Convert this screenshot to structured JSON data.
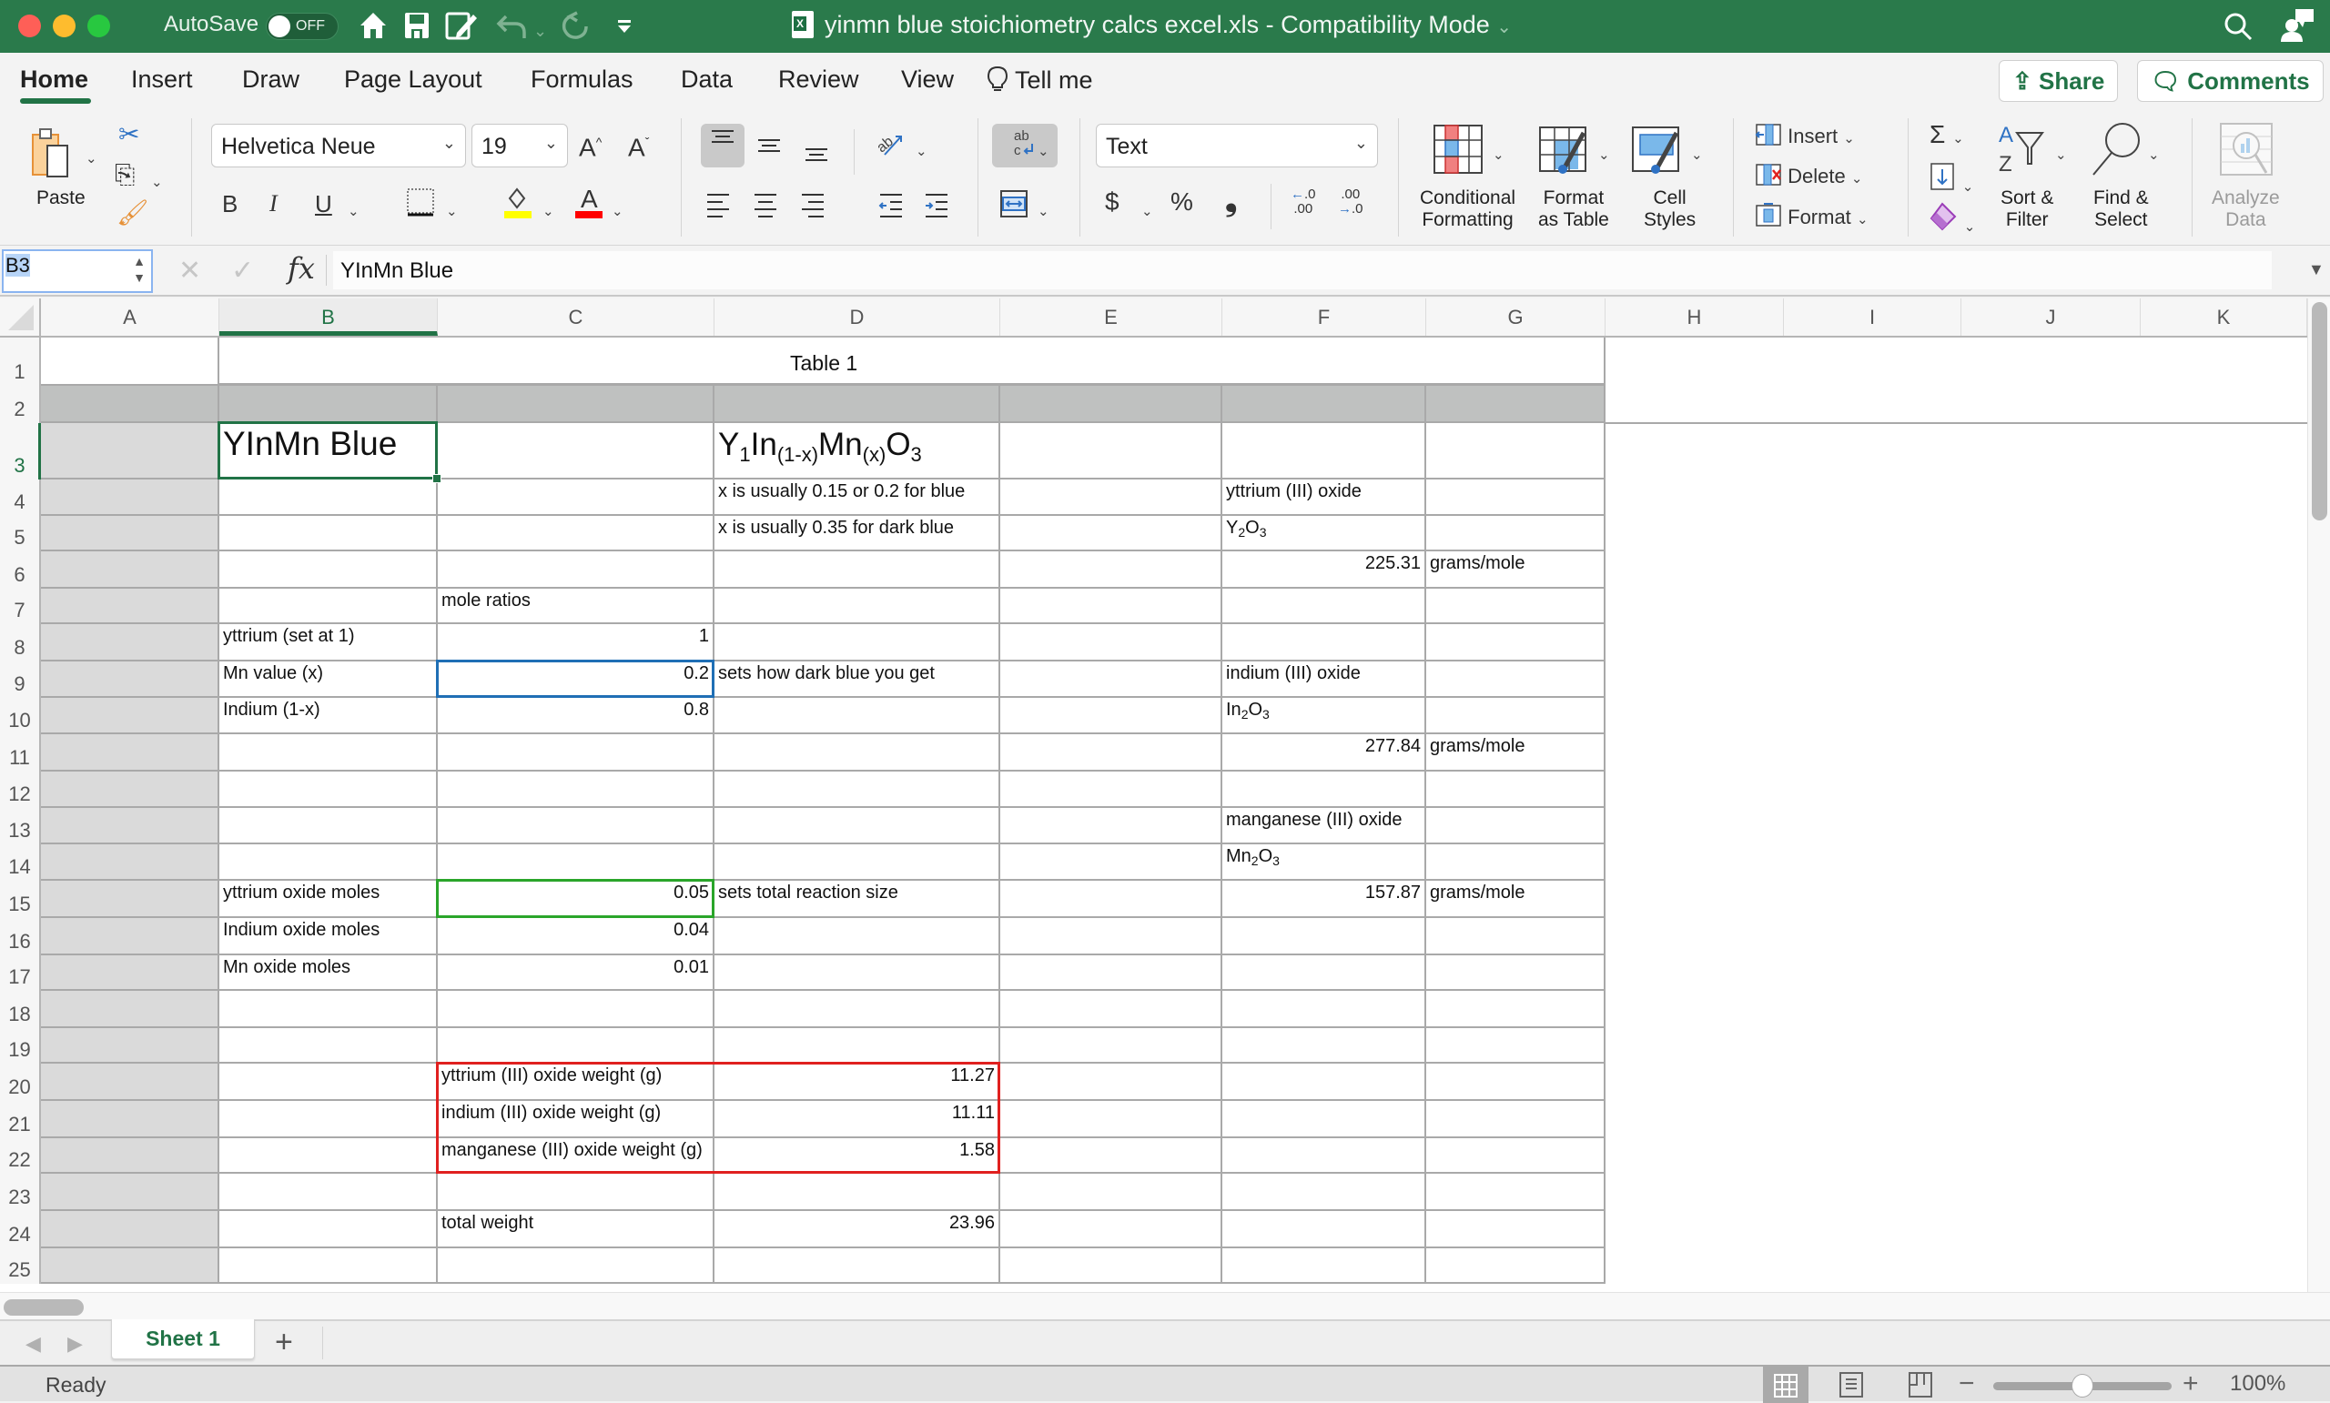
{
  "window": {
    "autosave_label": "AutoSave",
    "autosave_state": "OFF",
    "doc_title": "yinmn blue stoichiometry calcs excel.xls  -  Compatibility Mode",
    "doc_title_chevron": "⌄",
    "icons": [
      "home-icon",
      "save-icon",
      "edit-icon",
      "undo-icon",
      "redo-icon",
      "customize-toolbar-icon",
      "search-icon",
      "share-person-icon"
    ]
  },
  "ribbon_tabs": {
    "items": [
      {
        "label": "Home",
        "active": true
      },
      {
        "label": "Insert"
      },
      {
        "label": "Draw"
      },
      {
        "label": "Page Layout"
      },
      {
        "label": "Formulas"
      },
      {
        "label": "Data"
      },
      {
        "label": "Review"
      },
      {
        "label": "View"
      }
    ],
    "tell_me": "Tell me",
    "share": "Share",
    "comments": "Comments"
  },
  "ribbon": {
    "paste": "Paste",
    "font_name": "Helvetica Neue",
    "font_size": "19",
    "bold": "B",
    "italic": "I",
    "underline": "U",
    "number_format": "Text",
    "currency": "$",
    "percent": "%",
    "comma": "❟",
    "conditional_formatting": [
      "Conditional",
      "Formatting"
    ],
    "format_as_table": [
      "Format",
      "as Table"
    ],
    "cell_styles": [
      "Cell",
      "Styles"
    ],
    "insert": "Insert",
    "delete": "Delete",
    "format": "Format",
    "sort_filter": [
      "Sort &",
      "Filter"
    ],
    "find_select": [
      "Find &",
      "Select"
    ],
    "analyze_data": [
      "Analyze",
      "Data"
    ],
    "colors": {
      "highlight": "#ffff00",
      "font_color": "#ff0000"
    }
  },
  "formula_bar": {
    "name_box": "B3",
    "formula": "YInMn Blue",
    "fx": "fx"
  },
  "sheet": {
    "columns": [
      "A",
      "B",
      "C",
      "D",
      "E",
      "F",
      "G",
      "H",
      "I",
      "J",
      "K"
    ],
    "active_column": "B",
    "active_row": 3,
    "rows": [
      "1",
      "2",
      "3",
      "4",
      "5",
      "6",
      "7",
      "8",
      "9",
      "10",
      "11",
      "12",
      "13",
      "14",
      "15",
      "16",
      "17",
      "18",
      "19",
      "20",
      "21",
      "22",
      "23",
      "24",
      "25"
    ],
    "table_title": "Table 1",
    "cells": {
      "B3": "YInMn Blue",
      "D3": {
        "base": [
          "Y",
          "In",
          "Mn",
          "O"
        ],
        "subs": [
          "1",
          "(1-x)",
          "(x)",
          "3"
        ]
      },
      "D4": "x is usually 0.15 or 0.2 for blue",
      "D5": "x is usually 0.35 for dark blue",
      "F4": "yttrium (III) oxide",
      "F5": {
        "base": [
          "Y",
          "O"
        ],
        "subs": [
          "2",
          "3"
        ]
      },
      "F6": "225.31",
      "G6": "grams/mole",
      "C7": "mole ratios",
      "B8": "yttrium (set at 1)",
      "C8": "1",
      "B9": "Mn value (x)",
      "C9": "0.2",
      "D9": "sets how dark blue you get",
      "F9": "indium (III) oxide",
      "B10": "Indium (1-x)",
      "C10": "0.8",
      "F10": {
        "base": [
          "In",
          "O"
        ],
        "subs": [
          "2",
          "3"
        ]
      },
      "F11": "277.84",
      "G11": "grams/mole",
      "F13": "manganese (III) oxide",
      "F14": {
        "base": [
          "Mn",
          "O"
        ],
        "subs": [
          "2",
          "3"
        ]
      },
      "B15": "yttrium oxide moles",
      "C15": "0.05",
      "D15": "sets total reaction size",
      "F15": "157.87",
      "G15": "grams/mole",
      "B16": "Indium oxide moles",
      "C16": "0.04",
      "B17": "Mn oxide moles",
      "C17": "0.01",
      "C20": "yttrium (III) oxide weight (g)",
      "D20": "11.27",
      "C21": "indium (III) oxide weight (g)",
      "D21": "11.11",
      "C22": "manganese (III) oxide weight (g)",
      "D22": "1.58",
      "C24": "total weight",
      "D24": "23.96"
    },
    "highlight_colors": {
      "C9": "#1f6fb5",
      "C15": "#2aa52a",
      "C20:D22": "#e0201f"
    }
  },
  "sheet_tabs": {
    "tabs": [
      {
        "label": "Sheet 1",
        "active": true
      }
    ],
    "add": "+"
  },
  "status_bar": {
    "status": "Ready",
    "zoom": "100%",
    "zoom_percent": 100
  }
}
